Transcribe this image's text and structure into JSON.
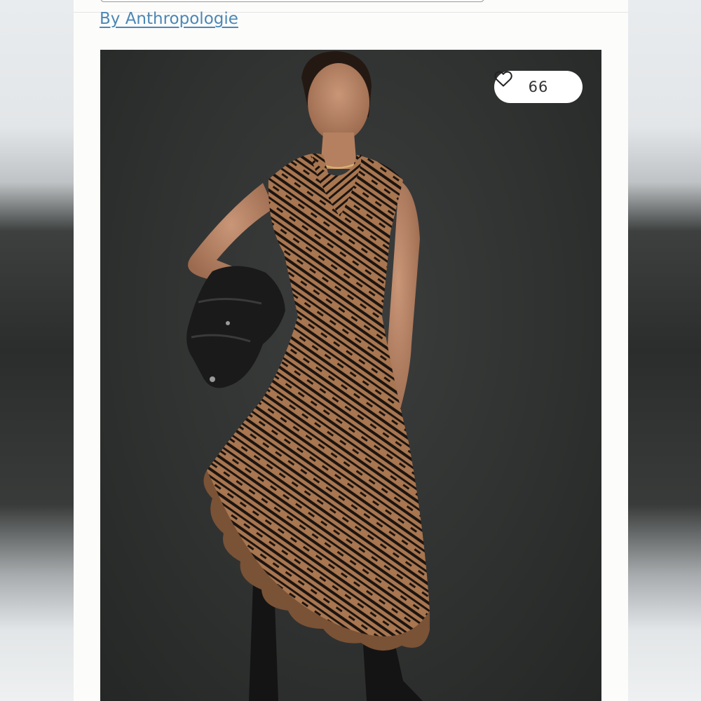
{
  "listing": {
    "brand_link": "By Anthropologie",
    "like_count": "66",
    "like_icon": "heart-outline-icon",
    "photo_subject": "model-in-printed-ruffle-midi-dress",
    "colors": {
      "brand_link": "#4b87b5",
      "photo_background": "#303231",
      "dress_base": "#a87650",
      "dress_print": "#1c1410"
    }
  }
}
